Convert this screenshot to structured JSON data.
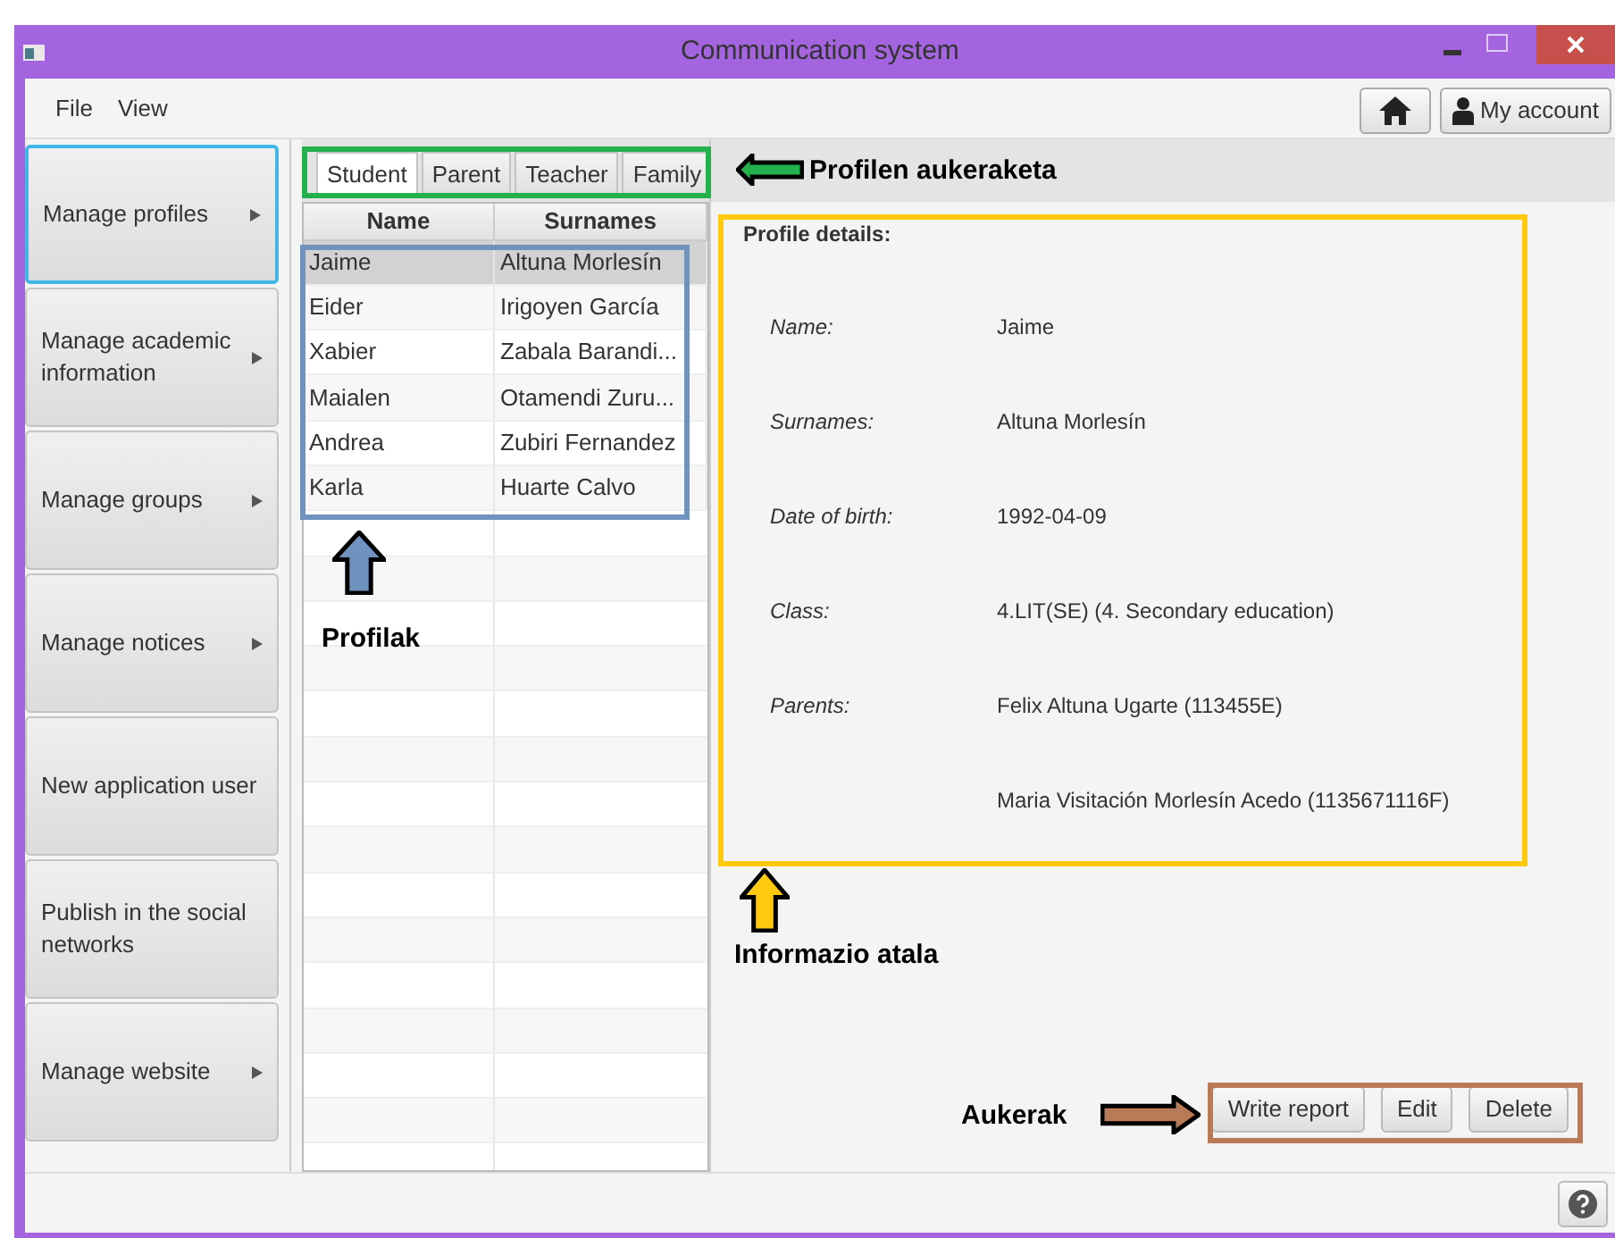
{
  "window": {
    "title": "Communication system"
  },
  "menu": [
    "File",
    "View"
  ],
  "toolbar": {
    "account_label": "My account"
  },
  "sidebar": [
    {
      "label": "Manage profiles",
      "submenu": true,
      "selected": true
    },
    {
      "label": "Manage academic information",
      "submenu": true,
      "selected": false
    },
    {
      "label": "Manage groups",
      "submenu": true,
      "selected": false
    },
    {
      "label": "Manage notices",
      "submenu": true,
      "selected": false
    },
    {
      "label": "New application user",
      "submenu": false,
      "selected": false
    },
    {
      "label": "Publish in the social networks",
      "submenu": false,
      "selected": false
    },
    {
      "label": "Manage website",
      "submenu": true,
      "selected": false
    }
  ],
  "tabs": [
    {
      "label": "Student",
      "selected": true
    },
    {
      "label": "Parent",
      "selected": false
    },
    {
      "label": "Teacher",
      "selected": false
    },
    {
      "label": "Family",
      "selected": false
    }
  ],
  "table": {
    "columns": [
      "Name",
      "Surnames"
    ],
    "rows": [
      {
        "cells": [
          "Jaime",
          "Altuna Morlesín"
        ],
        "selected": true
      },
      {
        "cells": [
          "Eider",
          "Irigoyen García"
        ],
        "selected": false
      },
      {
        "cells": [
          "Xabier",
          "Zabala Barandi..."
        ],
        "selected": false
      },
      {
        "cells": [
          "Maialen",
          "Otamendi Zuru..."
        ],
        "selected": false
      },
      {
        "cells": [
          "Andrea",
          "Zubiri Fernandez"
        ],
        "selected": false
      },
      {
        "cells": [
          "Karla",
          "Huarte Calvo"
        ],
        "selected": false
      }
    ]
  },
  "details": {
    "title": "Profile details:",
    "fields": [
      {
        "label": "Name:",
        "value": "Jaime"
      },
      {
        "label": "Surnames:",
        "value": "Altuna Morlesín"
      },
      {
        "label": "Date of birth:",
        "value": "1992-04-09"
      },
      {
        "label": "Class:",
        "value": "4.LIT(SE) (4. Secondary education)"
      },
      {
        "label": "Parents:",
        "value": "Felix Altuna Ugarte (113455E)"
      },
      {
        "value": "Maria Visitación Morlesín Acedo (1135671116F)"
      }
    ]
  },
  "actions": [
    "Write report",
    "Edit",
    "Delete"
  ],
  "annotations": [
    {
      "text": "Profilen aukeraketa",
      "color": "#22b14c",
      "kind": "left"
    },
    {
      "text": "Profilak",
      "color": "#7092be",
      "kind": "up"
    },
    {
      "text": "Informazio atala",
      "color": "#ffc90e",
      "kind": "up"
    },
    {
      "text": "Aukerak",
      "color": "#b97a57",
      "kind": "right"
    }
  ]
}
